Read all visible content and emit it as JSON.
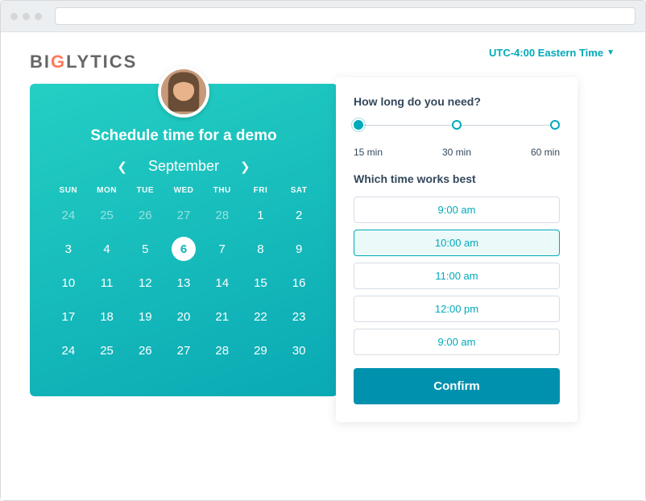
{
  "timezone": {
    "label": "UTC-4:00 Eastern Time"
  },
  "brand": {
    "pre": "BI",
    "accent": "G",
    "post": "LYTICS"
  },
  "calendar": {
    "title": "Schedule time for a demo",
    "month": "September",
    "dow": [
      "SUN",
      "MON",
      "TUE",
      "WED",
      "THU",
      "FRI",
      "SAT"
    ],
    "weeks": [
      [
        {
          "n": "24",
          "fade": true
        },
        {
          "n": "25",
          "fade": true
        },
        {
          "n": "26",
          "fade": true
        },
        {
          "n": "27",
          "fade": true
        },
        {
          "n": "28",
          "fade": true
        },
        {
          "n": "1"
        },
        {
          "n": "2"
        }
      ],
      [
        {
          "n": "3"
        },
        {
          "n": "4"
        },
        {
          "n": "5"
        },
        {
          "n": "6",
          "selected": true
        },
        {
          "n": "7"
        },
        {
          "n": "8"
        },
        {
          "n": "9"
        }
      ],
      [
        {
          "n": "10"
        },
        {
          "n": "11"
        },
        {
          "n": "12"
        },
        {
          "n": "13"
        },
        {
          "n": "14"
        },
        {
          "n": "15"
        },
        {
          "n": "16"
        }
      ],
      [
        {
          "n": "17"
        },
        {
          "n": "18"
        },
        {
          "n": "19"
        },
        {
          "n": "20"
        },
        {
          "n": "21"
        },
        {
          "n": "22"
        },
        {
          "n": "23"
        }
      ],
      [
        {
          "n": "24"
        },
        {
          "n": "25"
        },
        {
          "n": "26"
        },
        {
          "n": "27"
        },
        {
          "n": "28"
        },
        {
          "n": "29"
        },
        {
          "n": "30"
        }
      ]
    ]
  },
  "duration": {
    "question": "How long do you need?",
    "stops": [
      "15 min",
      "30 min",
      "60 min"
    ],
    "selectedIndex": 0
  },
  "time": {
    "question": "Which time works best",
    "options": [
      {
        "label": "9:00 am"
      },
      {
        "label": "10:00 am",
        "selected": true
      },
      {
        "label": "11:00 am"
      },
      {
        "label": "12:00 pm"
      },
      {
        "label": "9:00 am"
      }
    ]
  },
  "confirm": "Confirm"
}
